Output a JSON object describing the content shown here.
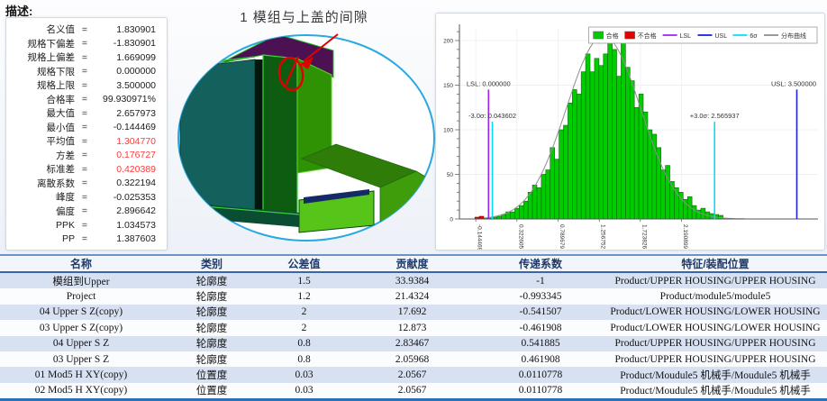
{
  "labels": {
    "description": "描述:",
    "equals": "="
  },
  "stats": {
    "rows": [
      {
        "label": "名义值",
        "value": "1.830901",
        "red": false
      },
      {
        "label": "规格下偏差",
        "value": "-1.830901",
        "red": false
      },
      {
        "label": "规格上偏差",
        "value": "1.669099",
        "red": false
      },
      {
        "label": "规格下限",
        "value": "0.000000",
        "red": false
      },
      {
        "label": "规格上限",
        "value": "3.500000",
        "red": false
      },
      {
        "label": "合格率",
        "value": "99.930971%",
        "red": false
      },
      {
        "label": "最大值",
        "value": "2.657973",
        "red": false
      },
      {
        "label": "最小值",
        "value": "-0.144469",
        "red": false
      },
      {
        "label": "平均值",
        "value": "1.304770",
        "red": true
      },
      {
        "label": "方差",
        "value": "0.176727",
        "red": true
      },
      {
        "label": "标准差",
        "value": "0.420389",
        "red": true
      },
      {
        "label": "离散系数",
        "value": "0.322194",
        "red": false
      },
      {
        "label": "峰度",
        "value": "-0.025353",
        "red": false
      },
      {
        "label": "偏度",
        "value": "2.896642",
        "red": false
      },
      {
        "label": "PPK",
        "value": "1.034573",
        "red": false
      },
      {
        "label": "PP",
        "value": "1.387603",
        "red": false
      }
    ]
  },
  "cad": {
    "title": "1 模组与上盖的间隙"
  },
  "chart_data": {
    "type": "bar",
    "subtype": "histogram",
    "title": "",
    "xlabel": "",
    "ylabel": "",
    "ylim": [
      0,
      210
    ],
    "yticks": [
      0,
      50,
      100,
      150,
      200
    ],
    "xlim": [
      -0.33,
      3.74
    ],
    "xticks": [
      -0.144469,
      0.322605,
      0.789679,
      1.256752,
      1.723826,
      2.190899
    ],
    "bin_start": -0.155,
    "bin_width": 0.0503,
    "fail_bin_count": 2,
    "values": [
      2,
      3,
      1,
      1,
      2,
      3,
      5,
      8,
      8,
      12,
      15,
      20,
      30,
      38,
      35,
      50,
      55,
      80,
      67,
      100,
      105,
      130,
      145,
      140,
      165,
      185,
      165,
      180,
      172,
      185,
      207,
      190,
      160,
      198,
      170,
      155,
      125,
      140,
      120,
      100,
      95,
      80,
      55,
      60,
      42,
      35,
      30,
      22,
      25,
      15,
      10,
      12,
      8,
      6,
      5,
      4
    ],
    "curve": {
      "mean": 1.30477,
      "sigma": 0.420389,
      "amplitude": 205
    },
    "colors": {
      "pass": "#00cc00",
      "fail": "#e60000",
      "lsl": "#a020f0",
      "usl": "#2020dd",
      "sigma": "#00e0ff",
      "curve": "#8f8f8f"
    },
    "lines": [
      {
        "name": "lsl-line",
        "value": 0.0,
        "top": 145,
        "label": "LSL: 0.000000",
        "color": "#a020f0"
      },
      {
        "name": "minus-3sigma-line",
        "value": 0.043602,
        "top": 109,
        "label": "-3.0σ: 0.043602",
        "color": "#00e0ff"
      },
      {
        "name": "plus-3sigma-line",
        "value": 2.565937,
        "top": 109,
        "label": "+3.0σ: 2.565937",
        "color": "#00e0ff"
      },
      {
        "name": "usl-line",
        "value": 3.5,
        "top": 145,
        "label": "USL: 3.500000",
        "color": "#2020dd"
      }
    ],
    "legend": [
      {
        "label": "合格",
        "type": "swatch",
        "color": "#00cc00"
      },
      {
        "label": "不合格",
        "type": "swatch",
        "color": "#e60000"
      },
      {
        "label": "LSL",
        "type": "line",
        "color": "#a020f0"
      },
      {
        "label": "USL",
        "type": "line",
        "color": "#2020dd"
      },
      {
        "label": "6σ",
        "type": "line",
        "color": "#00e0ff"
      },
      {
        "label": "分布曲线",
        "type": "line",
        "color": "#8f8f8f"
      }
    ],
    "legend_position": "top-right",
    "grid": true
  },
  "table": {
    "headers": [
      "名称",
      "类别",
      "公差值",
      "贡献度",
      "传递系数",
      "特征/装配位置"
    ],
    "rows": [
      [
        "模组到Upper",
        "轮廓度",
        "1.5",
        "33.9384",
        "-1",
        "Product/UPPER HOUSING/UPPER HOUSING"
      ],
      [
        "Project",
        "轮廓度",
        "1.2",
        "21.4324",
        "-0.993345",
        "Product/module5/module5"
      ],
      [
        "04 Upper S Z(copy)",
        "轮廓度",
        "2",
        "17.692",
        "-0.541507",
        "Product/LOWER HOUSING/LOWER HOUSING"
      ],
      [
        "03 Upper S Z(copy)",
        "轮廓度",
        "2",
        "12.873",
        "-0.461908",
        "Product/LOWER HOUSING/LOWER HOUSING"
      ],
      [
        "04 Upper S Z",
        "轮廓度",
        "0.8",
        "2.83467",
        "0.541885",
        "Product/UPPER HOUSING/UPPER HOUSING"
      ],
      [
        "03 Upper S Z",
        "轮廓度",
        "0.8",
        "2.05968",
        "0.461908",
        "Product/UPPER HOUSING/UPPER HOUSING"
      ],
      [
        "01 Mod5 H XY(copy)",
        "位置度",
        "0.03",
        "2.0567",
        "0.0110778",
        "Product/Moudule5 机械手/Moudule5 机械手"
      ],
      [
        "02 Mod5 H XY(copy)",
        "位置度",
        "0.03",
        "2.0567",
        "0.0110778",
        "Product/Moudule5 机械手/Moudule5 机械手"
      ]
    ]
  }
}
